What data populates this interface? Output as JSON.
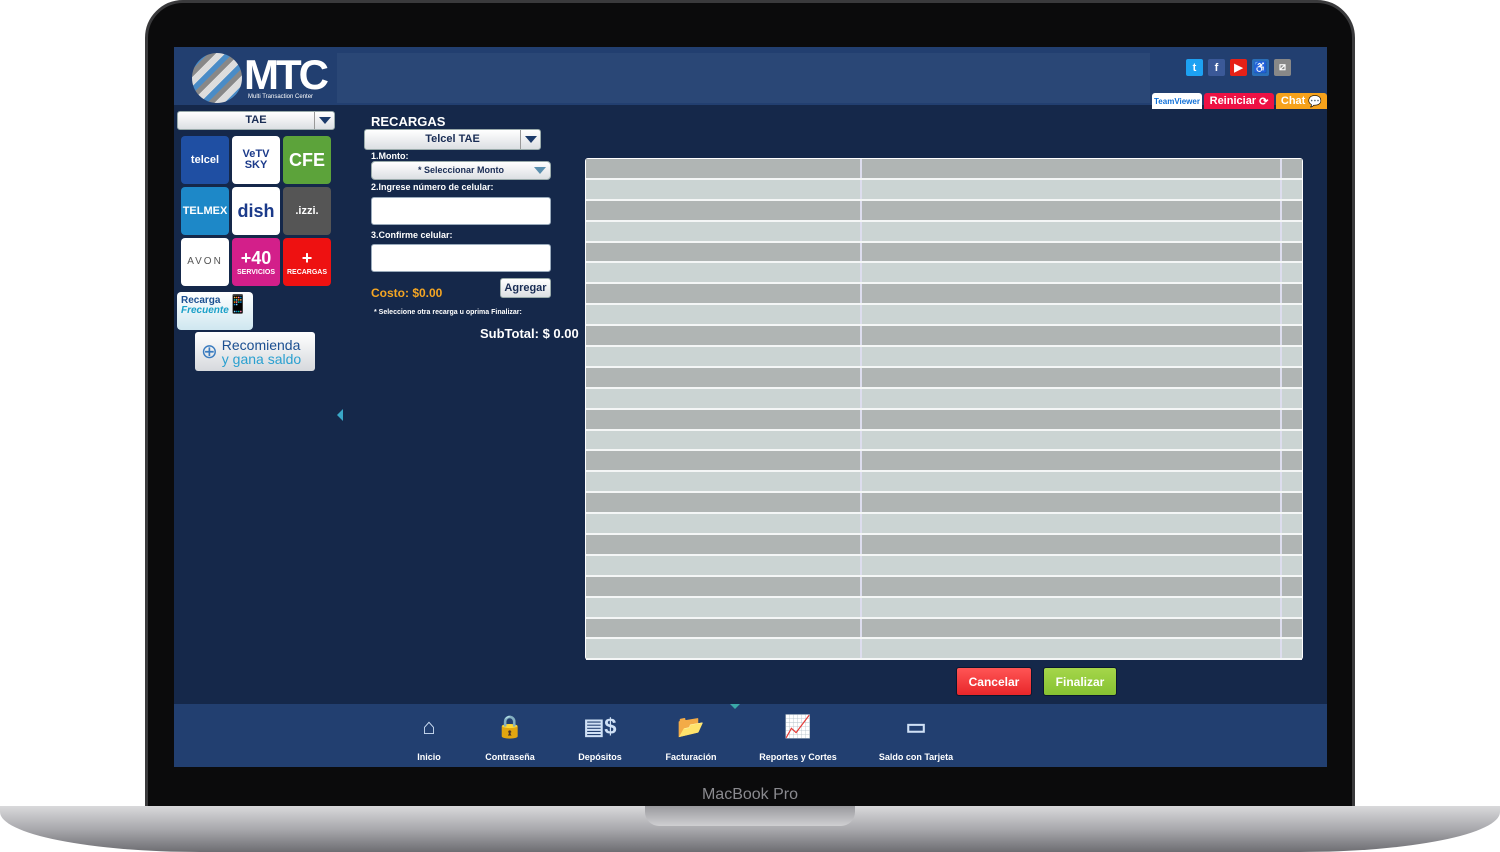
{
  "device": {
    "label": "MacBook Pro"
  },
  "header": {
    "logo_text": "MTC",
    "logo_sub": "Multi Transaction Center",
    "social": [
      {
        "icon": "twitter-icon",
        "glyph": "t",
        "color": "#1da1f2"
      },
      {
        "icon": "facebook-icon",
        "glyph": "f",
        "color": "#3b5998"
      },
      {
        "icon": "youtube-icon",
        "glyph": "▶",
        "color": "#e62117"
      },
      {
        "icon": "accessibility-icon",
        "glyph": "♿",
        "color": "#2a6fb8"
      },
      {
        "icon": "mtc-icon",
        "glyph": "⧄",
        "color": "#888"
      }
    ],
    "teamviewer": "TeamViewer",
    "reiniciar": "Reiniciar",
    "chat": "Chat"
  },
  "sidebar": {
    "category": "TAE",
    "tiles": [
      {
        "label": "telcel",
        "color": "#1f4fa3"
      },
      {
        "label": "VeTV SKY",
        "color": "#ffffff"
      },
      {
        "label": "CFE",
        "color": "#5ca33a"
      },
      {
        "label": "TELMEX",
        "color": "#1d88c8"
      },
      {
        "label": "dish",
        "color": "#ffffff"
      },
      {
        "label": ".izzi.",
        "color": "#555555"
      },
      {
        "label": "AVON",
        "color": "#ffffff"
      },
      {
        "label": "+40",
        "sub": "SERVICIOS",
        "color": "#d31f8a"
      },
      {
        "label": "+",
        "sub": "RECARGAS",
        "color": "#ee1111"
      }
    ],
    "recarga_frecuente": [
      "Recarga",
      "Frecuente"
    ],
    "recomienda": [
      "Recomienda",
      "y gana saldo"
    ]
  },
  "form": {
    "title": "RECARGAS",
    "carrier": "Telcel TAE",
    "monto_label": "1.Monto:",
    "monto_value": "* Seleccionar Monto",
    "celular_label": "2.Ingrese número de celular:",
    "celular_value": "",
    "confirm_label": "3.Confirme celular:",
    "confirm_value": "",
    "costo": "Costo: $0.00",
    "agregar": "Agregar",
    "note": "* Seleccione otra recarga u oprima Finalizar:",
    "subtotal": "SubTotal: $ 0.00"
  },
  "actions": {
    "cancelar": "Cancelar",
    "finalizar": "Finalizar"
  },
  "footer": {
    "items": [
      {
        "label": "Inicio",
        "icon": "home-icon",
        "glyph": "⌂"
      },
      {
        "label": "Contraseña",
        "icon": "lock-icon",
        "glyph": "🔒"
      },
      {
        "label": "Depósitos",
        "icon": "deposit-icon",
        "glyph": "▤$"
      },
      {
        "label": "Facturación",
        "icon": "folder-icon",
        "glyph": "📂"
      },
      {
        "label": "Reportes y Cortes",
        "icon": "chart-icon",
        "glyph": "📈"
      },
      {
        "label": "Saldo con Tarjeta",
        "icon": "card-icon",
        "glyph": "▭"
      }
    ]
  },
  "colors": {
    "background": "#15284a",
    "header": "#223f70",
    "costo": "#f5a623",
    "cancel": "#e8262a",
    "finalize": "#86c232",
    "row_dark": "#b0b5b4",
    "row_light": "#cbd4d3"
  }
}
